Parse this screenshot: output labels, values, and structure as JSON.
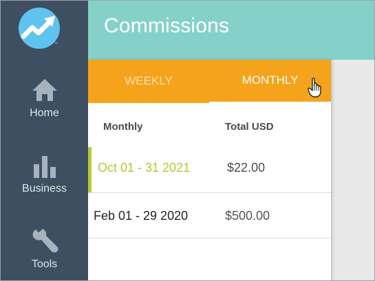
{
  "sidebar": {
    "logo_tm": "™",
    "items": [
      {
        "label": "Home",
        "icon": "home-icon"
      },
      {
        "label": "Business",
        "icon": "bar-chart-icon"
      },
      {
        "label": "Tools",
        "icon": "wrench-icon"
      }
    ]
  },
  "header": {
    "title": "Commissions"
  },
  "tabs": [
    {
      "label": "WEEKLY",
      "active": false
    },
    {
      "label": "MONTHLY",
      "active": true
    }
  ],
  "table": {
    "columns": [
      "Monthly",
      "Total USD"
    ],
    "rows": [
      {
        "period": "Oct 01 - 31 2021",
        "amount": "$22.00",
        "current": true
      },
      {
        "period": "Feb 01 - 29 2020",
        "amount": "$500.00",
        "current": false
      }
    ]
  },
  "colors": {
    "sidebar": "#3d4f60",
    "header": "#85d1ca",
    "tab_bar": "#f5a31a",
    "accent_green": "#b8cc2f",
    "logo": "#5fc3ef"
  }
}
